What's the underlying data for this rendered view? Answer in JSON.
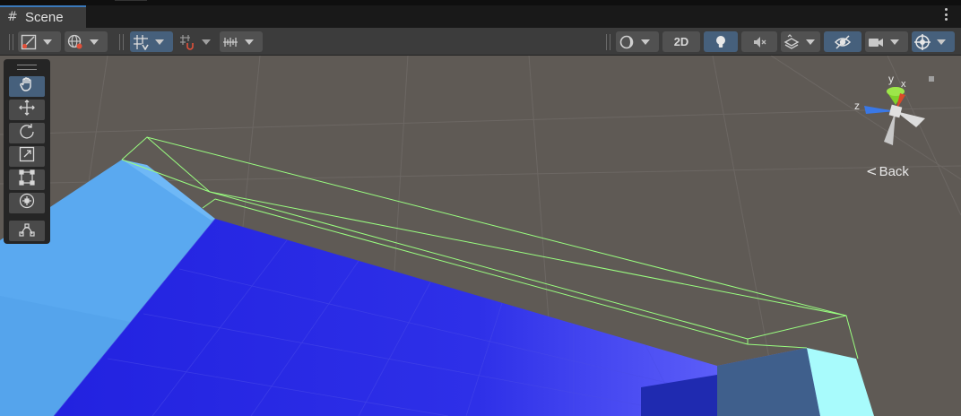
{
  "window": {
    "tab_label": "Scene",
    "tab_icon": "hash-icon"
  },
  "toolbar": {
    "mode_2d_label": "2D"
  },
  "scene": {
    "back_label": "Back",
    "axis_labels": {
      "y": "y",
      "x": "x",
      "z": "z"
    },
    "colors": {
      "background": "#5f5a55",
      "floor_blue": "#2a2ae6",
      "wall_light_blue": "#5aa9f0",
      "cyan_block": "#a8fbfc",
      "selection_outline": "#9aff80",
      "accent": "#46607c"
    }
  }
}
